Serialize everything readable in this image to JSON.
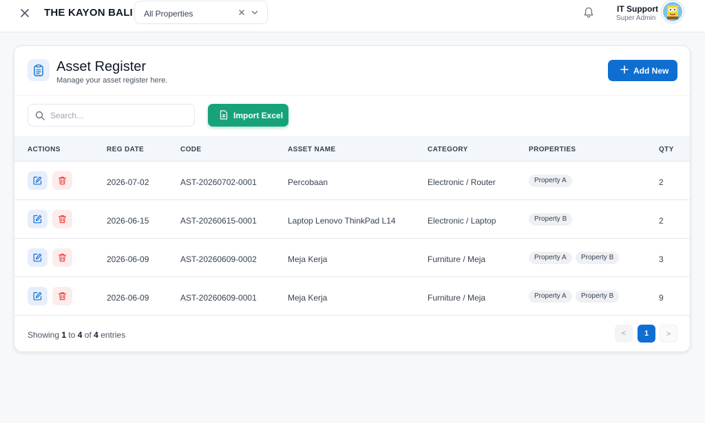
{
  "topbar": {
    "brand": "THE KAYON BALI",
    "property_filter": "All Properties",
    "user_name": "IT Support",
    "user_role": "Super Admin"
  },
  "page": {
    "title": "Asset Register",
    "subtitle": "Manage your asset register here.",
    "add_label": "Add New",
    "search_placeholder": "Search...",
    "import_label": "Import Excel"
  },
  "table": {
    "columns": [
      "ACTIONS",
      "REG DATE",
      "CODE",
      "ASSET NAME",
      "CATEGORY",
      "PROPERTIES",
      "QTY"
    ],
    "rows": [
      {
        "reg_date": "2026-07-02",
        "code": "AST-20260702-0001",
        "asset_name": "Percobaan",
        "category": "Electronic / Router",
        "properties": [
          "Property A"
        ],
        "qty": "2"
      },
      {
        "reg_date": "2026-06-15",
        "code": "AST-20260615-0001",
        "asset_name": "Laptop Lenovo ThinkPad L14",
        "category": "Electronic / Laptop",
        "properties": [
          "Property B"
        ],
        "qty": "2"
      },
      {
        "reg_date": "2026-06-09",
        "code": "AST-20260609-0002",
        "asset_name": "Meja Kerja",
        "category": "Furniture / Meja",
        "properties": [
          "Property A",
          "Property B"
        ],
        "qty": "3"
      },
      {
        "reg_date": "2026-06-09",
        "code": "AST-20260609-0001",
        "asset_name": "Meja Kerja",
        "category": "Furniture / Meja",
        "properties": [
          "Property A",
          "Property B"
        ],
        "qty": "9"
      }
    ]
  },
  "footer": {
    "showing_prefix": "Showing",
    "from": "1",
    "to_word": "to",
    "to": "4",
    "of_word": "of",
    "total": "4",
    "suffix": "entries",
    "prev": "<",
    "current_page": "1",
    "next": ">"
  },
  "colors": {
    "primary": "#0f6fd1",
    "success": "#16a37a",
    "danger": "#ef4444"
  },
  "icons": {
    "close": "close-icon",
    "bell": "bell-icon",
    "clipboard": "clipboard-icon",
    "search": "search-icon",
    "excel": "file-spreadsheet-icon",
    "edit": "edit-icon",
    "delete": "trash-icon"
  }
}
